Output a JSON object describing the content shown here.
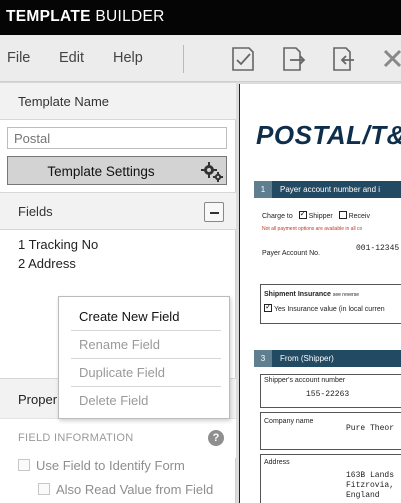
{
  "app": {
    "title_bold": "TEMPLATE",
    "title_light": "BUILDER"
  },
  "menu": {
    "file": "File",
    "edit": "Edit",
    "help": "Help"
  },
  "toolbar": {
    "icons": [
      "checklist-icon",
      "export-icon",
      "import-icon",
      "close-icon"
    ]
  },
  "template_name": {
    "header": "Template Name",
    "placeholder": "Postal",
    "settings_button": "Template Settings"
  },
  "fields": {
    "header": "Fields",
    "items": [
      "1 Tracking No",
      "2 Address"
    ]
  },
  "context_menu": {
    "items": [
      {
        "label": "Create New Field",
        "enabled": true
      },
      {
        "label": "Rename Field",
        "enabled": false
      },
      {
        "label": "Duplicate Field",
        "enabled": false
      },
      {
        "label": "Delete Field",
        "enabled": false
      }
    ]
  },
  "properties": {
    "header": "Proper",
    "field_information": "FIELD INFORMATION",
    "help_glyph": "?",
    "use_field": "Use Field to Identify Form",
    "also_read": "Also Read Value from Field"
  },
  "document": {
    "logo": "POSTAL/T&",
    "section1_num": "1",
    "section1_title": "Payer account number and i",
    "charge_to": "Charge to",
    "shipper": "Shipper",
    "receiver": "Receiv",
    "not_all": "Not all payment options are available in all co",
    "payer_account": "Payer Account No.",
    "payer_account_value": "001-12345",
    "insurance_title": "Shipment Insurance",
    "insurance_note": "see reverse",
    "insurance_yes": "Yes Insurance value (in local curren",
    "section3_num": "3",
    "section3_title": "From (Shipper)",
    "shipper_account": "Shipper's account number",
    "shipper_account_value": "155-22263",
    "company_name": "Company name",
    "company_value": "Pure Theor",
    "address": "Address",
    "address_line1": "163B Lands",
    "address_line2": "Fitzrovia,",
    "address_line3": "England"
  },
  "colors": {
    "titlebar_bg": "#050505",
    "doc_logo": "#0f2e4c",
    "section_bar": "#234a63"
  }
}
